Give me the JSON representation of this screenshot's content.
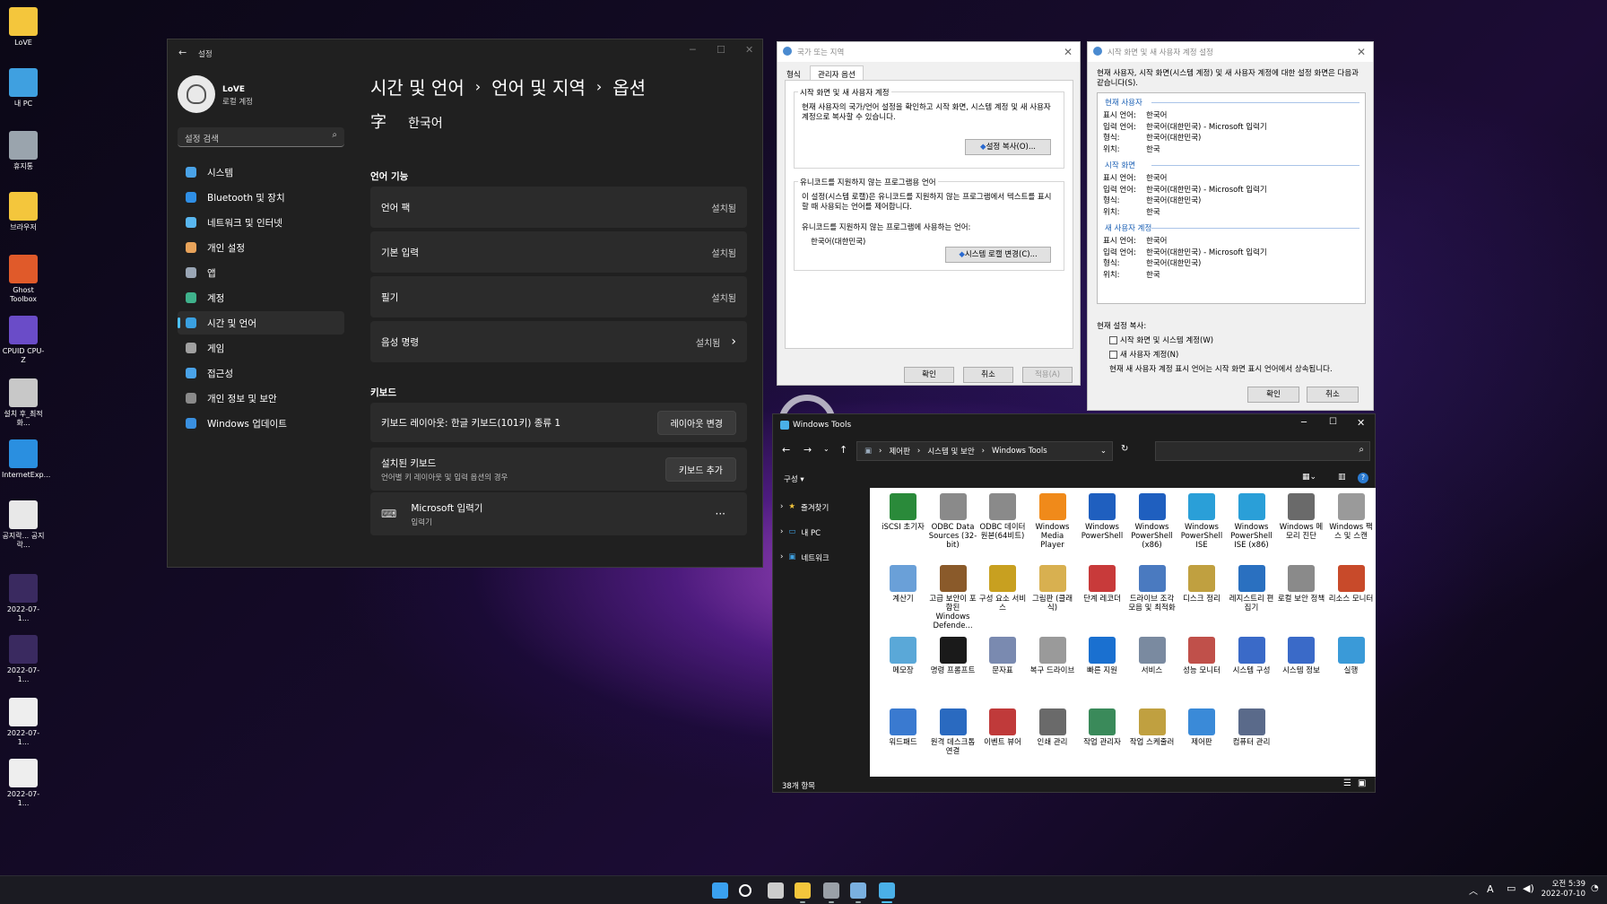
{
  "desktop_icons": [
    {
      "label": "LoVE",
      "icon": "folder-icon",
      "color": "#f4c63c"
    },
    {
      "label": "내 PC",
      "icon": "computer-icon",
      "color": "#3fa0e0"
    },
    {
      "label": "휴지통",
      "icon": "recycle-bin-icon",
      "color": "#9aa4ad"
    },
    {
      "label": "브라우저",
      "icon": "folder-icon",
      "color": "#f4c63c"
    },
    {
      "label": "Ghost Toolbox",
      "icon": "ghost-toolbox-icon",
      "color": "#e05a2a"
    },
    {
      "label": "CPUID CPU-Z",
      "icon": "cpuz-icon",
      "color": "#6a4cc8"
    },
    {
      "label": "설치 후_최적화...",
      "icon": "settings-shortcut-icon",
      "color": "#c8c8c8"
    },
    {
      "label": "InternetExp...",
      "icon": "internet-explorer-icon",
      "color": "#2a8fe0"
    },
    {
      "label": "공지락... 공지락...",
      "icon": "ie-document-icon",
      "color": "#e8e8e8"
    },
    {
      "label": "2022-07-1...",
      "icon": "image-file-icon",
      "color": "#3a2a60"
    },
    {
      "label": "2022-07-1...",
      "icon": "image-file-icon",
      "color": "#3a2a60"
    },
    {
      "label": "2022-07-1...",
      "icon": "image-file-icon",
      "color": "#eeeeee"
    },
    {
      "label": "2022-07-1...",
      "icon": "image-file-icon",
      "color": "#eeeeee"
    }
  ],
  "settings": {
    "title": "설정",
    "user_name": "LoVE",
    "user_type": "로컬 계정",
    "search_placeholder": "설정 검색",
    "nav": [
      {
        "label": "시스템",
        "color": "#4aa3e8"
      },
      {
        "label": "Bluetooth 및 장치",
        "color": "#2f8fe6"
      },
      {
        "label": "네트워크 및 인터넷",
        "color": "#59b7f0"
      },
      {
        "label": "개인 설정",
        "color": "#e8a35a"
      },
      {
        "label": "앱",
        "color": "#9aa6b5"
      },
      {
        "label": "계정",
        "color": "#3fb28c"
      },
      {
        "label": "시간 및 언어",
        "color": "#3aa0e0"
      },
      {
        "label": "게임",
        "color": "#a0a0a0"
      },
      {
        "label": "접근성",
        "color": "#4aa3e8"
      },
      {
        "label": "개인 정보 및 보안",
        "color": "#8a8a8a"
      },
      {
        "label": "Windows 업데이트",
        "color": "#3a90e0"
      }
    ],
    "breadcrumb": [
      "시간 및 언어",
      "언어 및 지역",
      "옵션"
    ],
    "lang_name": "한국어",
    "section_features": "언어 기능",
    "features": [
      {
        "name": "언어 팩",
        "status": "설치됨"
      },
      {
        "name": "기본 입력",
        "status": "설치됨"
      },
      {
        "name": "필기",
        "status": "설치됨"
      },
      {
        "name": "음성 명령",
        "status": "설치됨"
      }
    ],
    "section_keyboard": "키보드",
    "keyboard_layout": "키보드 레이아웃: 한글 키보드(101키) 종류 1",
    "change_layout_btn": "레이아웃 변경",
    "installed_kb_title": "설치된 키보드",
    "installed_kb_sub": "언어별 키 레이아웃 및 입력 옵션의 경우",
    "add_kb_btn": "키보드 추가",
    "ime_name": "Microsoft 입력기",
    "ime_sub": "입력기",
    "more": "···"
  },
  "region": {
    "title": "국가 또는 지역",
    "tabs": [
      "형식",
      "관리자 옵션"
    ],
    "group1_title": "시작 화면 및 새 사용자 계정",
    "group1_text": "현재 사용자의 국가/언어 설정을 확인하고 시작 화면, 시스템 계정 및 새 사용자 계정으로 복사할 수 있습니다.",
    "copy_btn": "설정 복사(O)...",
    "group2_title": "유니코드를 지원하지 않는 프로그램용 언어",
    "group2_text": "이 설정(시스템 로캘)은 유니코드를 지원하지 않는 프로그램에서 텍스트를 표시할 때 사용되는 언어를 제어합니다.",
    "current_label": "유니코드를 지원하지 않는 프로그램에 사용하는 언어:",
    "current_value": "한국어(대한민국)",
    "locale_btn": "시스템 로캘 변경(C)...",
    "ok": "확인",
    "cancel": "취소",
    "apply": "적용(A)"
  },
  "welcome": {
    "title": "시작 화면 및 새 사용자 계정 설정",
    "desc": "현재 사용자, 시작 화면(시스템 계정) 및 새 사용자 계정에 대한 설정 화면은 다음과 같습니다(S).",
    "sections": [
      {
        "header": "현재 사용자",
        "rows": [
          [
            "표시 언어:",
            "한국어"
          ],
          [
            "입력 언어:",
            "한국어(대한민국) - Microsoft 입력기"
          ],
          [
            "형식:",
            "한국어(대한민국)"
          ],
          [
            "위치:",
            "한국"
          ]
        ]
      },
      {
        "header": "시작 화면",
        "rows": [
          [
            "표시 언어:",
            "한국어"
          ],
          [
            "입력 언어:",
            "한국어(대한민국) - Microsoft 입력기"
          ],
          [
            "형식:",
            "한국어(대한민국)"
          ],
          [
            "위치:",
            "한국"
          ]
        ]
      },
      {
        "header": "새 사용자 계정",
        "rows": [
          [
            "표시 언어:",
            "한국어"
          ],
          [
            "입력 언어:",
            "한국어(대한민국) - Microsoft 입력기"
          ],
          [
            "형식:",
            "한국어(대한민국)"
          ],
          [
            "위치:",
            "한국"
          ]
        ]
      }
    ],
    "copy_label": "현재 설정 복사:",
    "chk1": "시작 화면 및 시스템 계정(W)",
    "chk2": "새 사용자 계정(N)",
    "note": "현재 새 사용자 계정 표시 언어는 시작 화면 표시 언어에서 상속됩니다.",
    "ok": "확인",
    "cancel": "취소"
  },
  "explorer": {
    "title": "Windows Tools",
    "path": [
      "제어판",
      "시스템 및 보안",
      "Windows Tools"
    ],
    "organize": "구성 ▾",
    "nav": [
      "즐겨찾기",
      "내 PC",
      "네트워크"
    ],
    "status": "38개 항목",
    "items": [
      {
        "label": "iSCSI 초기자",
        "color": "#2a8a3a"
      },
      {
        "label": "ODBC Data Sources (32-bit)",
        "color": "#8a8a8a"
      },
      {
        "label": "ODBC 데이터 원본(64비트)",
        "color": "#8a8a8a"
      },
      {
        "label": "Windows Media Player",
        "color": "#f08a1a"
      },
      {
        "label": "Windows PowerShell",
        "color": "#1f5fbf"
      },
      {
        "label": "Windows PowerShell (x86)",
        "color": "#1f5fbf"
      },
      {
        "label": "Windows PowerShell ISE",
        "color": "#2a9fd8"
      },
      {
        "label": "Windows PowerShell ISE (x86)",
        "color": "#2a9fd8"
      },
      {
        "label": "Windows 메모리 진단",
        "color": "#6a6a6a"
      },
      {
        "label": "Windows 팩스 및 스캔",
        "color": "#9a9a9a"
      },
      {
        "label": "계산기",
        "color": "#6aa0d8"
      },
      {
        "label": "고급 보안이 포함된 Windows Defende...",
        "color": "#8a5a2a"
      },
      {
        "label": "구성 요소 서비스",
        "color": "#c8a020"
      },
      {
        "label": "그림판 (클래식)",
        "color": "#d8b050"
      },
      {
        "label": "단계 레코더",
        "color": "#c83a3a"
      },
      {
        "label": "드라이브 조각 모음 및 최적화",
        "color": "#4a7ac0"
      },
      {
        "label": "디스크 정리",
        "color": "#c0a040"
      },
      {
        "label": "레지스트리 편집기",
        "color": "#2a70c0"
      },
      {
        "label": "로컬 보안 정책",
        "color": "#8a8a8a"
      },
      {
        "label": "리소스 모니터",
        "color": "#c84a2a"
      },
      {
        "label": "메모장",
        "color": "#5aa8d8"
      },
      {
        "label": "명령 프롬프트",
        "color": "#1a1a1a"
      },
      {
        "label": "문자표",
        "color": "#7a8ab0"
      },
      {
        "label": "복구 드라이브",
        "color": "#9a9a9a"
      },
      {
        "label": "빠른 지원",
        "color": "#1a70d0"
      },
      {
        "label": "서비스",
        "color": "#7a8aa0"
      },
      {
        "label": "성능 모니터",
        "color": "#c0504a"
      },
      {
        "label": "시스템 구성",
        "color": "#3a6ac8"
      },
      {
        "label": "시스템 정보",
        "color": "#3a6ac8"
      },
      {
        "label": "실행",
        "color": "#3a9ad8"
      },
      {
        "label": "워드패드",
        "color": "#3a7ad0"
      },
      {
        "label": "원격 데스크톱 연결",
        "color": "#2a6ac0"
      },
      {
        "label": "이벤트 뷰어",
        "color": "#c03a3a"
      },
      {
        "label": "인쇄 관리",
        "color": "#6a6a6a"
      },
      {
        "label": "작업 관리자",
        "color": "#3a8a5a"
      },
      {
        "label": "작업 스케줄러",
        "color": "#c0a040"
      },
      {
        "label": "제어판",
        "color": "#3a8ad8"
      },
      {
        "label": "컴퓨터 관리",
        "color": "#5a6a8a"
      }
    ]
  },
  "taskbar": {
    "time": "오전 5:39",
    "date": "2022-07-10",
    "ime": "A",
    "apps": [
      {
        "icon": "start-icon",
        "color": "#3aa0f0"
      },
      {
        "icon": "search-icon",
        "color": "#ffffff"
      },
      {
        "icon": "task-view-icon",
        "color": "#cccccc"
      },
      {
        "icon": "file-explorer-icon",
        "color": "#f4c63c"
      },
      {
        "icon": "settings-icon",
        "color": "#9aa0a8"
      },
      {
        "icon": "language-icon",
        "color": "#7ab0e0"
      },
      {
        "icon": "windows-tools-icon",
        "color": "#4ab0e8"
      }
    ]
  }
}
